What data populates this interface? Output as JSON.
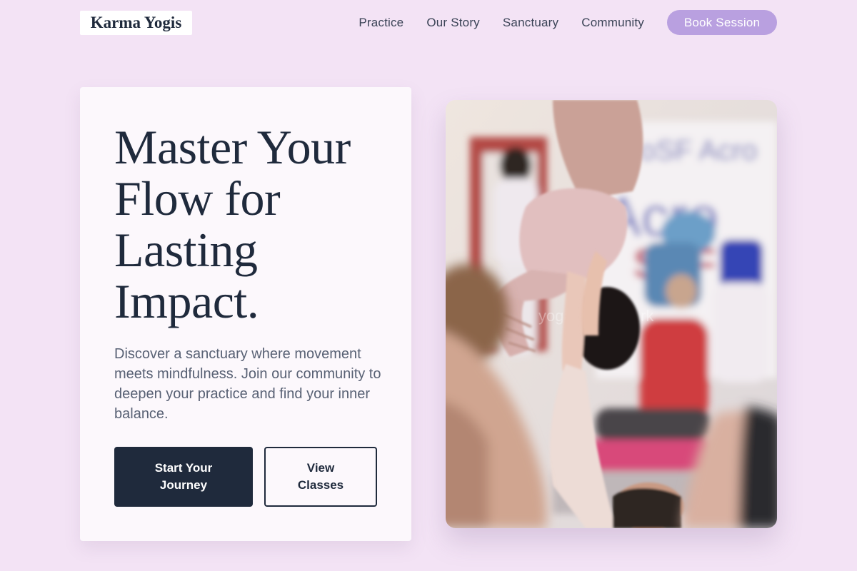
{
  "header": {
    "logo": "Karma Yogis",
    "nav": [
      {
        "label": "Practice"
      },
      {
        "label": "Our Story"
      },
      {
        "label": "Sanctuary"
      },
      {
        "label": "Community"
      }
    ],
    "cta_label": "Book Session"
  },
  "hero": {
    "title": "Master Your Flow for Lasting Impact.",
    "description": "Discover a sanctuary where movement meets mindfulness. Join our community to deepen your practice and find your inner balance.",
    "primary_button": "Start Your Journey",
    "secondary_button": "View Classes",
    "image": {
      "watermark": "yogamasterwork",
      "banner_text": "Acro"
    }
  },
  "colors": {
    "page_background": "#f3e3f5",
    "card_background": "#fcf8fc",
    "navy": "#1f2a3c",
    "accent_lavender": "#b9a0e0"
  }
}
